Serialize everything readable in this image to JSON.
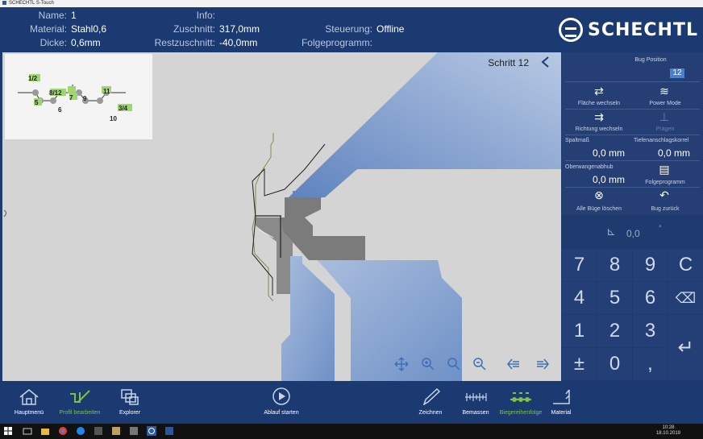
{
  "window": {
    "title": "SCHECHTL S-Touch"
  },
  "header": {
    "name_label": "Name:",
    "name_value": "1",
    "material_label": "Material:",
    "material_value": "Stahl0,6",
    "dicke_label": "Dicke:",
    "dicke_value": "0,6mm",
    "info_label": "Info:",
    "info_value": "",
    "zuschnitt_label": "Zuschnitt:",
    "zuschnitt_value": "317,0mm",
    "restzuschnitt_label": "Restzuschnitt:",
    "restzuschnitt_value": "-40,0mm",
    "steuerung_label": "Steuerung:",
    "steuerung_value": "Offline",
    "folgeprogramm_label": "Folgeprogramm:",
    "folgeprogramm_value": ""
  },
  "logo": {
    "text": "SCHECHTL"
  },
  "preview": {
    "labels": [
      "1/2",
      "8/12",
      "7",
      "9",
      "11",
      "5",
      "6",
      "3/4",
      "10"
    ]
  },
  "step": {
    "text": "Schritt 12"
  },
  "controls": {
    "bug_position_label": "Bug Position",
    "bug_position_value": "12",
    "flaeche_label": "Fläche wechseln",
    "power_label": "Power Mode",
    "richtung_label": "Richtung wechseln",
    "praegen_label": "Prägen",
    "spaltmass_label": "Spaltmaß",
    "spaltmass_value": "0,0 mm",
    "tiefen_label": "Tiefenanschlagskorrel",
    "tiefen_value": "0,0 mm",
    "oberwangen_label": "Oberwangenabhub",
    "oberwangen_value": "0,0 mm",
    "folgeprogramm_label": "Folgeprogramm",
    "alle_loeschen_label": "Alle Büge löschen",
    "bug_zurueck_label": "Bug zurück",
    "angle_value": "0,0",
    "angle_unit": "°"
  },
  "keypad": [
    "7",
    "8",
    "9",
    "C",
    "4",
    "5",
    "6",
    "⌫",
    "1",
    "2",
    "3",
    "↵",
    "±",
    "0",
    ","
  ],
  "bottom": {
    "hauptmenue": "Hauptmenü",
    "profil": "Profil bearbeiten",
    "explorer": "Explorer",
    "ablauf": "Ablauf starten",
    "zeichnen": "Zeichnen",
    "bemassen": "Bemassen",
    "biegereihenfolge": "Biegereihenfolge",
    "material": "Material"
  },
  "taskbar": {
    "time": "10:28",
    "date": "18.10.2019"
  },
  "colors": {
    "header_bg": "#1c3a72",
    "accent_green": "#7cc242",
    "panel_bg": "#253f75",
    "tool_blue": "#9bb2d6"
  }
}
